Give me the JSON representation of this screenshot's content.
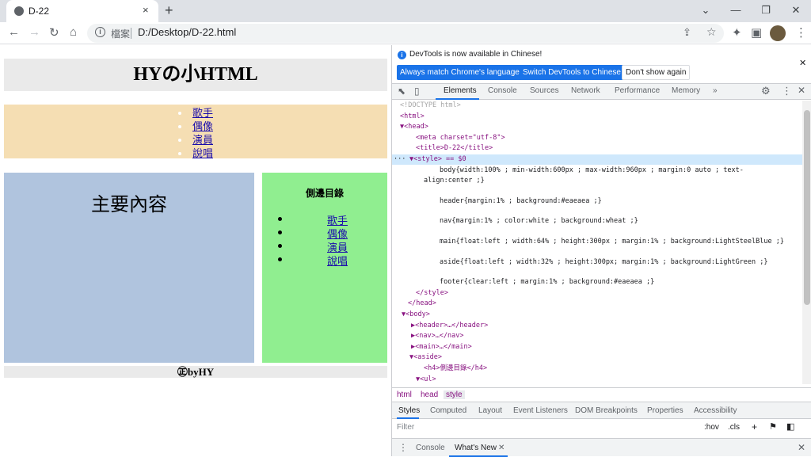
{
  "browser": {
    "tab_title": "D-22",
    "tab_close": "×",
    "new_tab": "+",
    "omnibox_label": "檔案",
    "url": "D:/Desktop/D-22.html",
    "window_controls": [
      "⌄",
      "—",
      "❐",
      "✕"
    ]
  },
  "page": {
    "header": "HYの小HTML",
    "nav_items": [
      "歌手",
      "偶像",
      "演員",
      "說唱"
    ],
    "main_title": "主要內容",
    "aside_title": "側邊目錄",
    "aside_items": [
      "歌手",
      "偶像",
      "演員",
      "說唱"
    ],
    "footer": "㊣byHY"
  },
  "devtools": {
    "banner_text": "DevTools is now available in Chinese!",
    "banner_buttons": [
      "Always match Chrome's language",
      "Switch DevTools to Chinese",
      "Don't show again"
    ],
    "tabs": [
      "Elements",
      "Console",
      "Sources",
      "Network",
      "Performance",
      "Memory",
      "»"
    ],
    "code_lines": [
      "<!DOCTYPE html>",
      "<html>",
      "▼<head>",
      "<meta charset=\"utf-8\">",
      "<title>D-22</title>",
      "▼<style> == $0",
      "body{width:100% ; min-width:600px ; max-width:960px ; margin:0 auto ; text-",
      "align:center ;}",
      "header{margin:1% ; background:#eaeaea ;}",
      "nav{margin:1% ; color:white ; background:wheat ;}",
      "main{float:left ; width:64% ; height:300px ; margin:1% ; background:LightSteelBlue ;}",
      "aside{float:left ; width:32% ; height:300px; margin:1% ; background:LightGreen ;}",
      "footer{clear:left ; margin:1% ; background:#eaeaea ;}",
      "</style>",
      "</head>",
      "▼<body>",
      "▶<header>…</header>",
      "▶<nav>…</nav>",
      "▶<main>…</main>",
      "▼<aside>",
      "<h4>側邊目錄</h4>",
      "▼<ul>"
    ],
    "breadcrumbs": [
      "html",
      "head",
      "style"
    ],
    "sub_tabs": [
      "Styles",
      "Computed",
      "Layout",
      "Event Listeners",
      "DOM Breakpoints",
      "Properties",
      "Accessibility"
    ],
    "filter_placeholder": "Filter",
    "filter_hov": ":hov",
    "filter_cls": ".cls",
    "drawer_tabs": [
      "Console",
      "What's New"
    ],
    "drawer_close": "✕"
  }
}
